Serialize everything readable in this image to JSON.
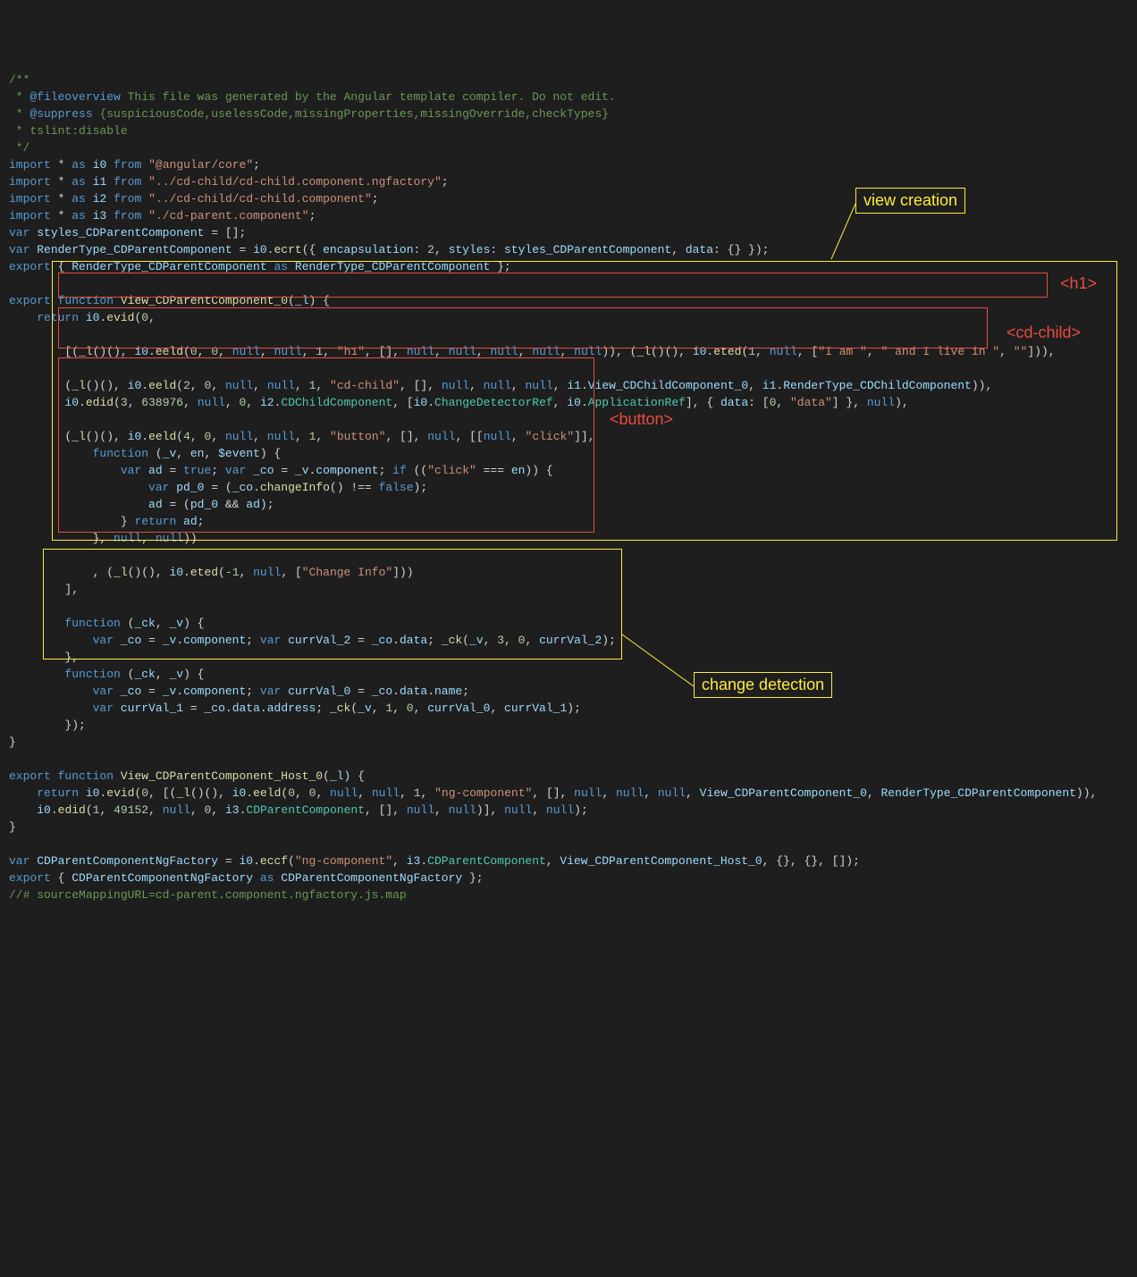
{
  "code": {
    "c1": "/**",
    "c2": " * ",
    "c2tag": "@fileoverview",
    "c2rest": " This file was generated by the Angular template compiler. Do not edit.",
    "c3": " * ",
    "c3tag": "@suppress",
    "c3rest": " {suspiciousCode,uselessCode,missingProperties,missingOverride,checkTypes}",
    "c4": " * tslint:disable",
    "c5": " */",
    "imp": "import",
    "as": "as",
    "from": "from",
    "star": "*",
    "i0": "i0",
    "i1": "i1",
    "i2": "i2",
    "i3": "i3",
    "s0": "\"@angular/core\"",
    "s1": "\"../cd-child/cd-child.component.ngfactory\"",
    "s2": "\"../cd-child/cd-child.component\"",
    "s3": "\"./cd-parent.component\"",
    "var": "var",
    "styles": "styles_CDParentComponent",
    "render": "RenderType_CDParentComponent",
    "ecrt": "ecrt",
    "enc": "encapsulation",
    "stylesK": "styles",
    "dataK": "data",
    "export": "export",
    "function": "function",
    "return": "return",
    "if": "if",
    "view0": "View_CDParentComponent_0",
    "l": "_l",
    "evid": "evid",
    "eeld": "eeld",
    "eted": "eted",
    "edid": "edid",
    "null": "null",
    "true": "true",
    "false": "false",
    "h1": "\"h1\"",
    "iam": "\"I am \"",
    "live": "\" and I live in \"",
    "empty": "\"\"",
    "cdchild": "\"cd-child\"",
    "viewChild": "View_CDChildComponent_0",
    "renderChild": "RenderType_CDChildComponent",
    "cdChildComp": "CDChildComponent",
    "changeDetRef": "ChangeDetectorRef",
    "appRef": "ApplicationRef",
    "dataStr": "\"data\"",
    "button": "\"button\"",
    "click": "\"click\"",
    "v": "_v",
    "en": "en",
    "event": "$event",
    "ad": "ad",
    "co": "_co",
    "component": "component",
    "pd0": "pd_0",
    "changeInfo": "changeInfo",
    "changeInfoStr": "\"Change Info\"",
    "ck": "_ck",
    "currVal2": "currVal_2",
    "dataP": "data",
    "currVal0": "currVal_0",
    "currVal1": "currVal_1",
    "name": "name",
    "address": "address",
    "viewHost": "View_CDParentComponent_Host_0",
    "ngcomp": "\"ng-component\"",
    "cdParent": "CDParentComponent",
    "factory": "CDParentComponentNgFactory",
    "eccf": "eccf",
    "srcmap": "//# sourceMappingURL=cd-parent.component.ngfactory.js.map",
    "n2": "2",
    "n0": "0",
    "n1": "1",
    "n3": "3",
    "n4": "4",
    "n638976": "638976",
    "n49152": "49152",
    "nm1": "-1"
  },
  "labels": {
    "viewCreation": "view creation",
    "changeDetection": "change detection",
    "h1": "<h1>",
    "cdchild": "<cd-child>",
    "button": "<button>"
  }
}
